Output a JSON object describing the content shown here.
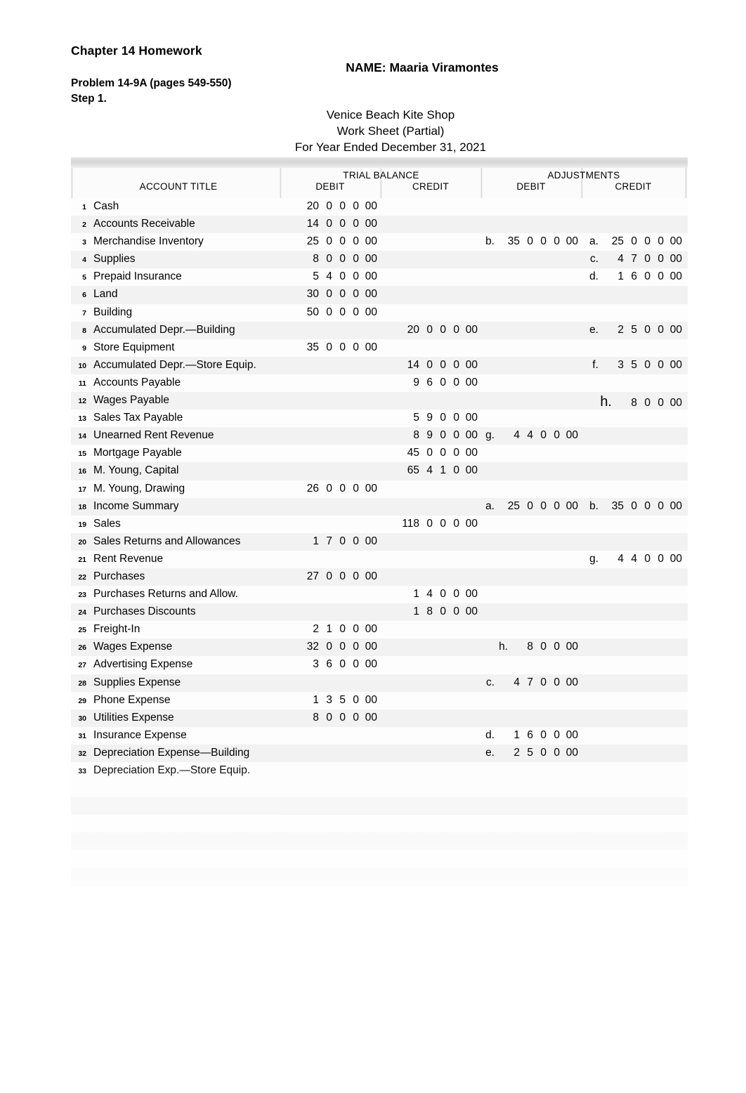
{
  "document": {
    "homework_title": "Chapter 14 Homework",
    "name_line": "NAME: Maaria Viramontes",
    "problem_line": "Problem 14-9A (pages 549-550)",
    "step_line": "Step 1.",
    "company": "Venice Beach Kite Shop",
    "sheet_title": "Work Sheet (Partial)",
    "period": "For Year Ended December 31, 2021"
  },
  "table": {
    "account_title_header": "ACCOUNT TITLE",
    "groups": {
      "trial_balance": "TRIAL BALANCE",
      "adjustments": "ADJUSTMENTS"
    },
    "subheaders": {
      "tb_debit": "DEBIT",
      "tb_credit": "CREDIT",
      "adj_debit": "DEBIT",
      "adj_credit": "CREDIT"
    },
    "rows": [
      {
        "n": "1",
        "account": "Cash",
        "tb_debit": {
          "ref": "",
          "amount": "20 0 0 0 00"
        },
        "tb_credit": null,
        "adj_debit": null,
        "adj_credit": null
      },
      {
        "n": "2",
        "account": "Accounts Receivable",
        "tb_debit": {
          "ref": "",
          "amount": "14 0 0 0 00"
        },
        "tb_credit": null,
        "adj_debit": null,
        "adj_credit": null
      },
      {
        "n": "3",
        "account": "Merchandise Inventory",
        "tb_debit": {
          "ref": "",
          "amount": "25 0 0 0 00"
        },
        "tb_credit": null,
        "adj_debit": {
          "ref": "b.",
          "amount": "35 0 0 0 00"
        },
        "adj_credit": {
          "ref": "a.",
          "amount": "25 0 0 0 00"
        }
      },
      {
        "n": "4",
        "account": "Supplies",
        "tb_debit": {
          "ref": "",
          "amount": "8 0 0 0 00"
        },
        "tb_credit": null,
        "adj_debit": null,
        "adj_credit": {
          "ref": "c.",
          "amount": "4 7 0 0 00"
        }
      },
      {
        "n": "5",
        "account": "Prepaid Insurance",
        "tb_debit": {
          "ref": "",
          "amount": "5 4 0 0 00"
        },
        "tb_credit": null,
        "adj_debit": null,
        "adj_credit": {
          "ref": "d.",
          "amount": "1 6 0 0 00"
        }
      },
      {
        "n": "6",
        "account": "Land",
        "tb_debit": {
          "ref": "",
          "amount": "30 0 0 0 00"
        },
        "tb_credit": null,
        "adj_debit": null,
        "adj_credit": null
      },
      {
        "n": "7",
        "account": "Building",
        "tb_debit": {
          "ref": "",
          "amount": "50 0 0 0 00"
        },
        "tb_credit": null,
        "adj_debit": null,
        "adj_credit": null
      },
      {
        "n": "8",
        "account": "Accumulated Depr.—Building",
        "tb_debit": null,
        "tb_credit": {
          "ref": "",
          "amount": "20 0 0 0 00"
        },
        "adj_debit": null,
        "adj_credit": {
          "ref": "e.",
          "amount": "2 5 0 0 00"
        }
      },
      {
        "n": "9",
        "account": "Store Equipment",
        "tb_debit": {
          "ref": "",
          "amount": "35 0 0 0 00"
        },
        "tb_credit": null,
        "adj_debit": null,
        "adj_credit": null
      },
      {
        "n": "10",
        "account": "Accumulated Depr.—Store Equip.",
        "tb_debit": null,
        "tb_credit": {
          "ref": "",
          "amount": "14 0 0 0 00"
        },
        "adj_debit": null,
        "adj_credit": {
          "ref": "f.",
          "amount": "3 5 0 0 00"
        }
      },
      {
        "n": "11",
        "account": "Accounts Payable",
        "tb_debit": null,
        "tb_credit": {
          "ref": "",
          "amount": "9 6 0 0 00"
        },
        "adj_debit": null,
        "adj_credit": null
      },
      {
        "n": "12",
        "account": "Wages Payable",
        "tb_debit": null,
        "tb_credit": null,
        "adj_debit": null,
        "adj_credit": {
          "ref": "h.",
          "amount": "8 0 0 00",
          "ref_large": true
        }
      },
      {
        "n": "13",
        "account": "Sales Tax Payable",
        "tb_debit": null,
        "tb_credit": {
          "ref": "",
          "amount": "5 9 0 0 00"
        },
        "adj_debit": null,
        "adj_credit": null
      },
      {
        "n": "14",
        "account": "Unearned Rent Revenue",
        "tb_debit": null,
        "tb_credit": {
          "ref": "",
          "amount": "8 9 0 0 00"
        },
        "adj_debit": {
          "ref": "g.",
          "amount": "4 4 0 0 00"
        },
        "adj_credit": null
      },
      {
        "n": "15",
        "account": "Mortgage Payable",
        "tb_debit": null,
        "tb_credit": {
          "ref": "",
          "amount": "45 0 0 0 00"
        },
        "adj_debit": null,
        "adj_credit": null
      },
      {
        "n": "16",
        "account": "M. Young, Capital",
        "tb_debit": null,
        "tb_credit": {
          "ref": "",
          "amount": "65 4 1 0 00"
        },
        "adj_debit": null,
        "adj_credit": null
      },
      {
        "n": "17",
        "account": "M. Young, Drawing",
        "tb_debit": {
          "ref": "",
          "amount": "26 0 0 0 00"
        },
        "tb_credit": null,
        "adj_debit": null,
        "adj_credit": null
      },
      {
        "n": "18",
        "account": "Income Summary",
        "tb_debit": null,
        "tb_credit": null,
        "adj_debit": {
          "ref": "a.",
          "amount": "25 0 0 0 00"
        },
        "adj_credit": {
          "ref": "b.",
          "amount": "35 0 0 0 00"
        }
      },
      {
        "n": "19",
        "account": "Sales",
        "tb_debit": null,
        "tb_credit": {
          "ref": "",
          "amount": "118 0 0 0 00"
        },
        "adj_debit": null,
        "adj_credit": null
      },
      {
        "n": "20",
        "account": "Sales Returns and Allowances",
        "tb_debit": {
          "ref": "",
          "amount": "1 7 0 0 00"
        },
        "tb_credit": null,
        "adj_debit": null,
        "adj_credit": null
      },
      {
        "n": "21",
        "account": "Rent Revenue",
        "tb_debit": null,
        "tb_credit": null,
        "adj_debit": null,
        "adj_credit": {
          "ref": "g.",
          "amount": "4 4 0 0 00"
        }
      },
      {
        "n": "22",
        "account": "Purchases",
        "tb_debit": {
          "ref": "",
          "amount": "27 0 0 0 00"
        },
        "tb_credit": null,
        "adj_debit": null,
        "adj_credit": null
      },
      {
        "n": "23",
        "account": "Purchases Returns and Allow.",
        "tb_debit": null,
        "tb_credit": {
          "ref": "",
          "amount": "1 4 0 0 00"
        },
        "adj_debit": null,
        "adj_credit": null
      },
      {
        "n": "24",
        "account": "Purchases Discounts",
        "tb_debit": null,
        "tb_credit": {
          "ref": "",
          "amount": "1 8 0 0 00"
        },
        "adj_debit": null,
        "adj_credit": null
      },
      {
        "n": "25",
        "account": "Freight-In",
        "tb_debit": {
          "ref": "",
          "amount": "2 1 0 0 00"
        },
        "tb_credit": null,
        "adj_debit": null,
        "adj_credit": null
      },
      {
        "n": "26",
        "account": "Wages Expense",
        "tb_debit": {
          "ref": "",
          "amount": "32 0 0 0 00"
        },
        "tb_credit": null,
        "adj_debit": {
          "ref": "h.",
          "amount": "8 0 0 00"
        },
        "adj_credit": null
      },
      {
        "n": "27",
        "account": "Advertising Expense",
        "tb_debit": {
          "ref": "",
          "amount": "3 6 0 0 00"
        },
        "tb_credit": null,
        "adj_debit": null,
        "adj_credit": null
      },
      {
        "n": "28",
        "account": "Supplies Expense",
        "tb_debit": null,
        "tb_credit": null,
        "adj_debit": {
          "ref": "c.",
          "amount": "4 7 0 0 00"
        },
        "adj_credit": null
      },
      {
        "n": "29",
        "account": "Phone Expense",
        "tb_debit": {
          "ref": "",
          "amount": "1 3 5 0 00"
        },
        "tb_credit": null,
        "adj_debit": null,
        "adj_credit": null
      },
      {
        "n": "30",
        "account": "Utilities Expense",
        "tb_debit": {
          "ref": "",
          "amount": "8 0 0 0 00"
        },
        "tb_credit": null,
        "adj_debit": null,
        "adj_credit": null
      },
      {
        "n": "31",
        "account": "Insurance Expense",
        "tb_debit": null,
        "tb_credit": null,
        "adj_debit": {
          "ref": "d.",
          "amount": "1 6 0 0 00"
        },
        "adj_credit": null
      },
      {
        "n": "32",
        "account": "Depreciation Expense—Building",
        "tb_debit": null,
        "tb_credit": null,
        "adj_debit": {
          "ref": "e.",
          "amount": "2 5 0 0 00"
        },
        "adj_credit": null
      },
      {
        "n": "33",
        "account": "Depreciation Exp.—Store Equip.",
        "tb_debit": null,
        "tb_credit": null,
        "adj_debit": null,
        "adj_credit": null
      }
    ]
  }
}
